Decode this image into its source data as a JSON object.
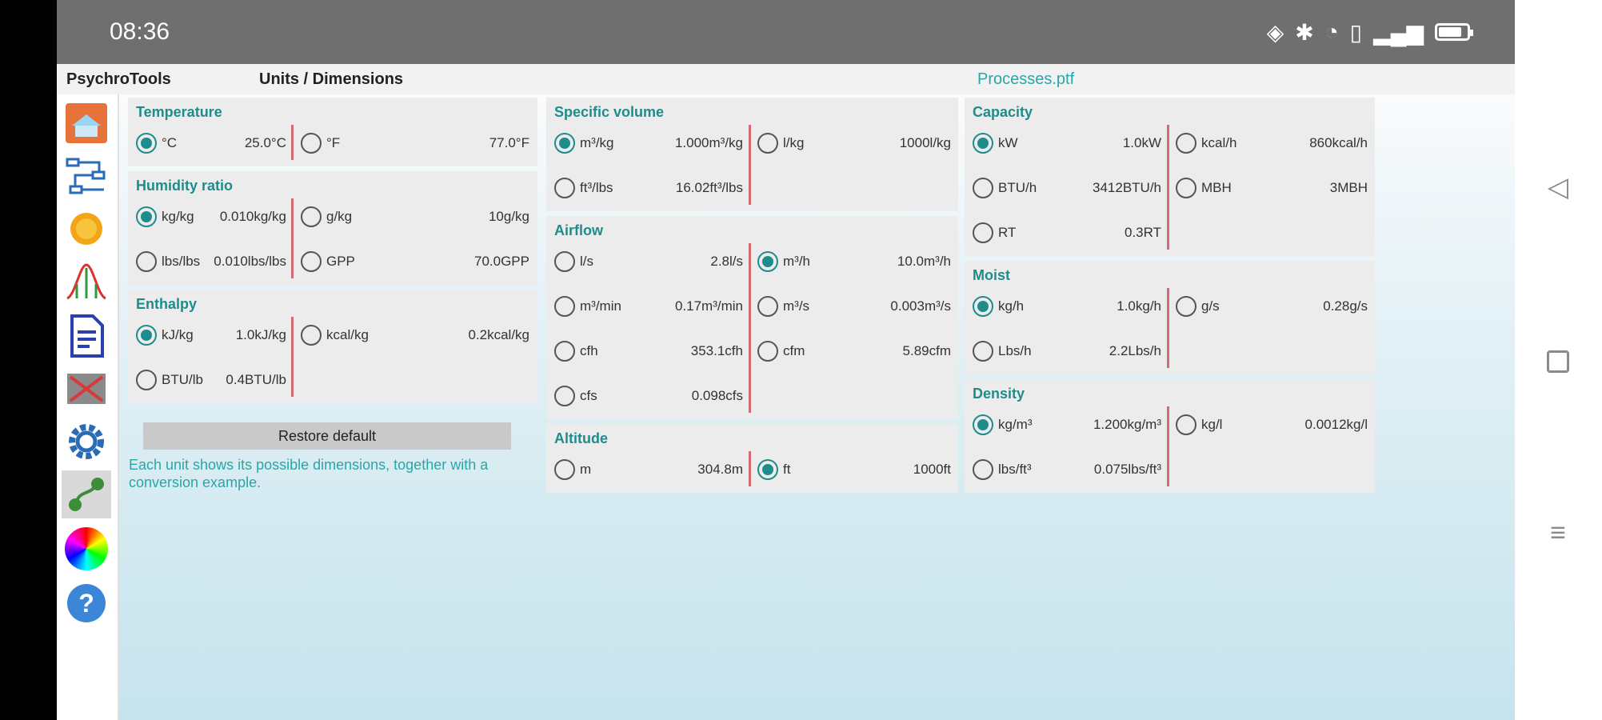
{
  "status": {
    "time": "08:36"
  },
  "header": {
    "app_name": "PsychroTools",
    "page_title": "Units / Dimensions",
    "file_name": "Processes.ptf"
  },
  "sidebar": {
    "items": [
      {
        "icon": "house-icon"
      },
      {
        "icon": "diagram-icon"
      },
      {
        "icon": "sun-icon"
      },
      {
        "icon": "graph-icon"
      },
      {
        "icon": "document-icon"
      },
      {
        "icon": "calculator-icon"
      },
      {
        "icon": "gear-icon"
      },
      {
        "icon": "units-icon"
      },
      {
        "icon": "color-wheel-icon"
      },
      {
        "icon": "help-icon"
      }
    ]
  },
  "panels": {
    "temperature": {
      "title": "Temperature",
      "options": [
        {
          "label": "°C",
          "value": "25.0°C",
          "selected": true
        },
        {
          "label": "°F",
          "value": "77.0°F",
          "selected": false
        }
      ]
    },
    "humidity": {
      "title": "Humidity ratio",
      "options": [
        {
          "label": "kg/kg",
          "value": "0.010kg/kg",
          "selected": true
        },
        {
          "label": "g/kg",
          "value": "10g/kg",
          "selected": false
        },
        {
          "label": "lbs/lbs",
          "value": "0.010lbs/lbs",
          "selected": false
        },
        {
          "label": "GPP",
          "value": "70.0GPP",
          "selected": false
        }
      ]
    },
    "enthalpy": {
      "title": "Enthalpy",
      "options": [
        {
          "label": "kJ/kg",
          "value": "1.0kJ/kg",
          "selected": true
        },
        {
          "label": "kcal/kg",
          "value": "0.2kcal/kg",
          "selected": false
        },
        {
          "label": "BTU/lb",
          "value": "0.4BTU/lb",
          "selected": false
        }
      ]
    },
    "specific_volume": {
      "title": "Specific volume",
      "options": [
        {
          "label": "m³/kg",
          "value": "1.000m³/kg",
          "selected": true
        },
        {
          "label": "l/kg",
          "value": "1000l/kg",
          "selected": false
        },
        {
          "label": "ft³/lbs",
          "value": "16.02ft³/lbs",
          "selected": false
        }
      ]
    },
    "airflow": {
      "title": "Airflow",
      "options": [
        {
          "label": "l/s",
          "value": "2.8l/s",
          "selected": false
        },
        {
          "label": "m³/h",
          "value": "10.0m³/h",
          "selected": true
        },
        {
          "label": "m³/min",
          "value": "0.17m³/min",
          "selected": false
        },
        {
          "label": "m³/s",
          "value": "0.003m³/s",
          "selected": false
        },
        {
          "label": "cfh",
          "value": "353.1cfh",
          "selected": false
        },
        {
          "label": "cfm",
          "value": "5.89cfm",
          "selected": false
        },
        {
          "label": "cfs",
          "value": "0.098cfs",
          "selected": false
        }
      ]
    },
    "altitude": {
      "title": "Altitude",
      "options": [
        {
          "label": "m",
          "value": "304.8m",
          "selected": false
        },
        {
          "label": "ft",
          "value": "1000ft",
          "selected": true
        }
      ]
    },
    "capacity": {
      "title": "Capacity",
      "options": [
        {
          "label": "kW",
          "value": "1.0kW",
          "selected": true
        },
        {
          "label": "kcal/h",
          "value": "860kcal/h",
          "selected": false
        },
        {
          "label": "BTU/h",
          "value": "3412BTU/h",
          "selected": false
        },
        {
          "label": "MBH",
          "value": "3MBH",
          "selected": false
        },
        {
          "label": "RT",
          "value": "0.3RT",
          "selected": false
        }
      ]
    },
    "moist": {
      "title": "Moist",
      "options": [
        {
          "label": "kg/h",
          "value": "1.0kg/h",
          "selected": true
        },
        {
          "label": "g/s",
          "value": "0.28g/s",
          "selected": false
        },
        {
          "label": "Lbs/h",
          "value": "2.2Lbs/h",
          "selected": false
        }
      ]
    },
    "density": {
      "title": "Density",
      "options": [
        {
          "label": "kg/m³",
          "value": "1.200kg/m³",
          "selected": true
        },
        {
          "label": "kg/l",
          "value": "0.0012kg/l",
          "selected": false
        },
        {
          "label": "lbs/ft³",
          "value": "0.075lbs/ft³",
          "selected": false
        }
      ]
    }
  },
  "restore_label": "Restore default",
  "note": "Each unit shows its possible dimensions, together with a conversion example."
}
